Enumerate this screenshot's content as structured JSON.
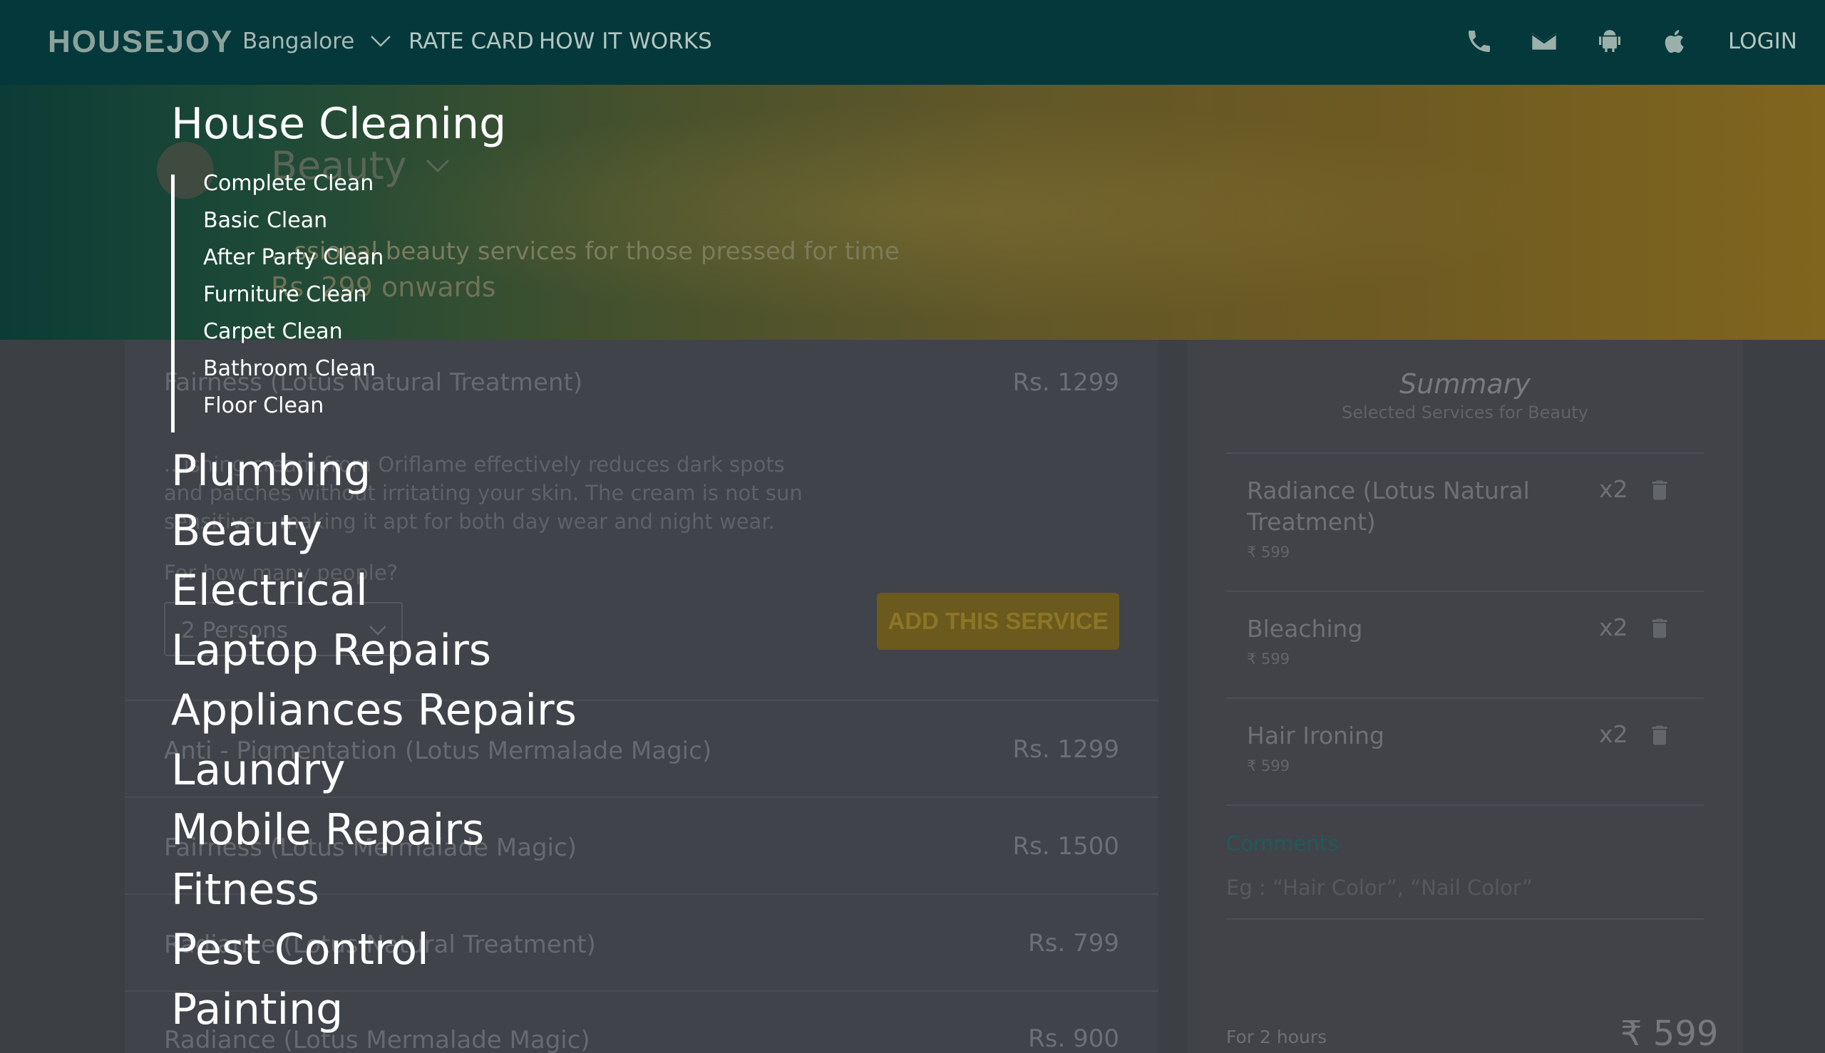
{
  "header": {
    "logo": "HOUSEJOY",
    "city": "Bangalore",
    "nav": [
      "RATE CARD",
      "HOW IT WORKS"
    ],
    "icons": [
      "phone-icon",
      "mail-icon",
      "android-icon",
      "apple-icon"
    ],
    "login": "LOGIN"
  },
  "banner": {
    "title": "Beauty",
    "subtitle": "...ssional beauty services for those pressed for time",
    "price": "Rs. 299 onwards"
  },
  "services": {
    "items": [
      {
        "name": "Fairness (Lotus Natural Treatment)",
        "price": "Rs. 1299"
      },
      {
        "name": "Anti - Pigmentation (Lotus Mermalade Magic)",
        "price": "Rs. 1299"
      },
      {
        "name": "Fairness (Lotus Mermalade Magic)",
        "price": "Rs. 1500"
      },
      {
        "name": "Radiance (Lotus Natural Treatment)",
        "price": "Rs. 799"
      },
      {
        "name": "Radiance (Lotus Mermalade Magic)",
        "price": "Rs. 900"
      }
    ],
    "expanded": {
      "description": "...ishing cream from Oriflame effectively reduces dark spots and patches without irritating your skin. The cream is not sun sensitive – making it apt for both day wear and night wear.",
      "question": "For how many people?",
      "persons_value": "2 Persons",
      "add_button": "ADD THIS SERVICE"
    }
  },
  "summary": {
    "title": "Summary",
    "subtitle": "Selected Services for Beauty",
    "items": [
      {
        "name": "Radiance (Lotus Natural Treatment)",
        "price": "₹ 599",
        "qty": "x2"
      },
      {
        "name": "Bleaching",
        "price": "₹ 599",
        "qty": "x2"
      },
      {
        "name": "Hair Ironing",
        "price": "₹ 599",
        "qty": "x2"
      }
    ],
    "comments_label": "Comments",
    "comments_placeholder": "Eg : “Hair Color”, “Nail Color”",
    "duration": "For 2 hours",
    "total": "₹ 599"
  },
  "menu": {
    "categories": [
      "House Cleaning",
      "Plumbing",
      "Beauty",
      "Electrical",
      "Laptop Repairs",
      "Appliances Repairs",
      "Laundry",
      "Mobile Repairs",
      "Fitness",
      "Pest Control",
      "Painting"
    ],
    "house_cleaning_sub": [
      "Complete Clean",
      "Basic Clean",
      "After Party Clean",
      "Furniture Clean",
      "Carpet Clean",
      "Bathroom Clean",
      "Floor Clean"
    ]
  },
  "colors": {
    "header_bg": "#05383a",
    "accent_gold": "#6b5a1d",
    "comments_teal": "#1f5a5b"
  }
}
